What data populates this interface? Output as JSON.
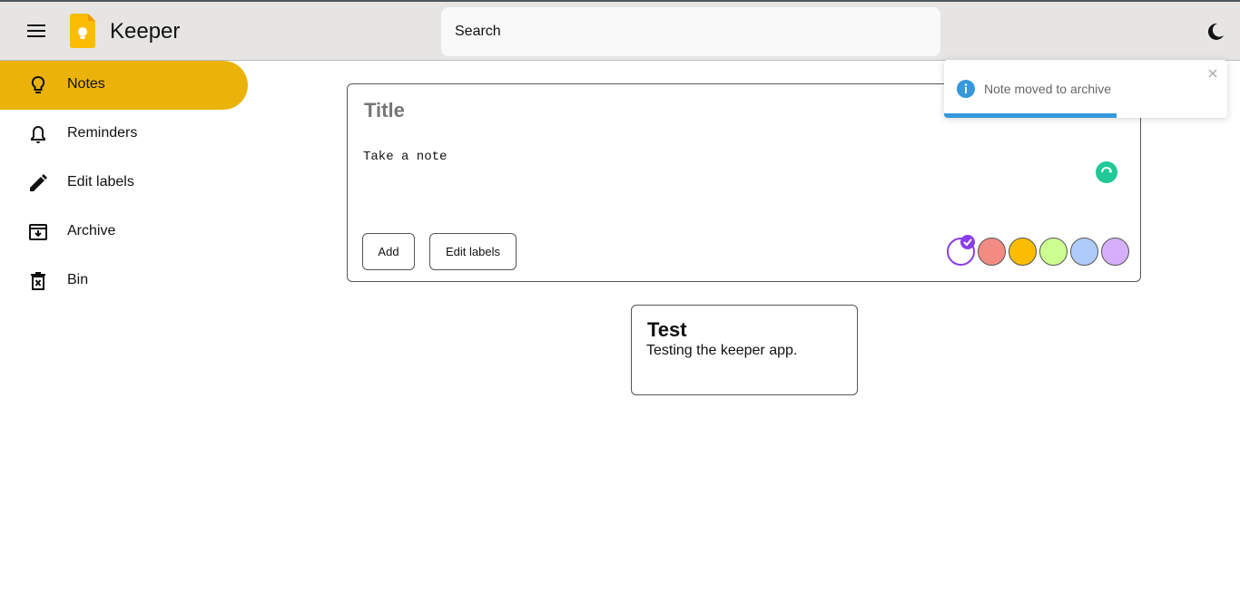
{
  "app": {
    "title": "Keeper"
  },
  "search": {
    "placeholder": "Search"
  },
  "sidebar": {
    "items": [
      {
        "label": "Notes",
        "icon": "lightbulb-icon",
        "active": true
      },
      {
        "label": "Reminders",
        "icon": "bell-icon",
        "active": false
      },
      {
        "label": "Edit labels",
        "icon": "pencil-icon",
        "active": false
      },
      {
        "label": "Archive",
        "icon": "archive-icon",
        "active": false
      },
      {
        "label": "Bin",
        "icon": "bin-icon",
        "active": false
      }
    ]
  },
  "composer": {
    "title_placeholder": "Title",
    "body_placeholder": "Take a note",
    "add_label": "Add",
    "edit_labels_label": "Edit labels",
    "colors": [
      "#ffffff",
      "#f28b82",
      "#fbbc04",
      "#ccff90",
      "#aecbfa",
      "#d7aefb"
    ],
    "selected_color_index": 0
  },
  "notes": [
    {
      "title": "Test",
      "body": "Testing the keeper app."
    }
  ],
  "toast": {
    "message": "Note moved to archive",
    "progress": 0.61,
    "accent": "#3498db"
  },
  "colors": {
    "active_nav": "#ebb30a",
    "topbar": "#e6e5e3",
    "selected_swatch": "#8a3ee8",
    "spinner": "#20c997"
  }
}
